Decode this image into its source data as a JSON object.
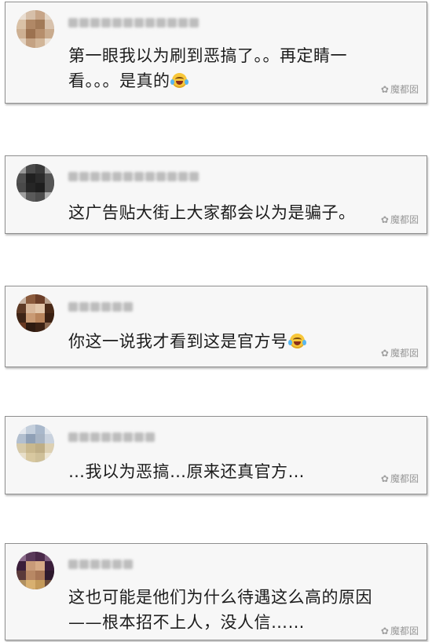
{
  "watermark": {
    "text": "魔都囡",
    "icon": "wechat-icon"
  },
  "comments": [
    {
      "line1": "第一眼我以为刷到恶搞了。。再定睛一",
      "line2": "看。。。是真的",
      "emoji": "laugh-cry-emoji"
    },
    {
      "line1": "这广告贴大街上大家都会以为是骗子。"
    },
    {
      "line1": "你这一说我才看到这是官方号",
      "emoji": "laugh-cry-emoji"
    },
    {
      "line1": "…我以为恶搞…原来还真官方…"
    },
    {
      "line1": "这也可能是他们为什么待遇这么高的原因",
      "line2": "——根本招不上人，没人信……"
    }
  ],
  "colors": {
    "card_bg": "#f7f7f7",
    "card_border": "#8e8e8e",
    "text": "#1c1c1c",
    "watermark": "#9a9a9a"
  }
}
